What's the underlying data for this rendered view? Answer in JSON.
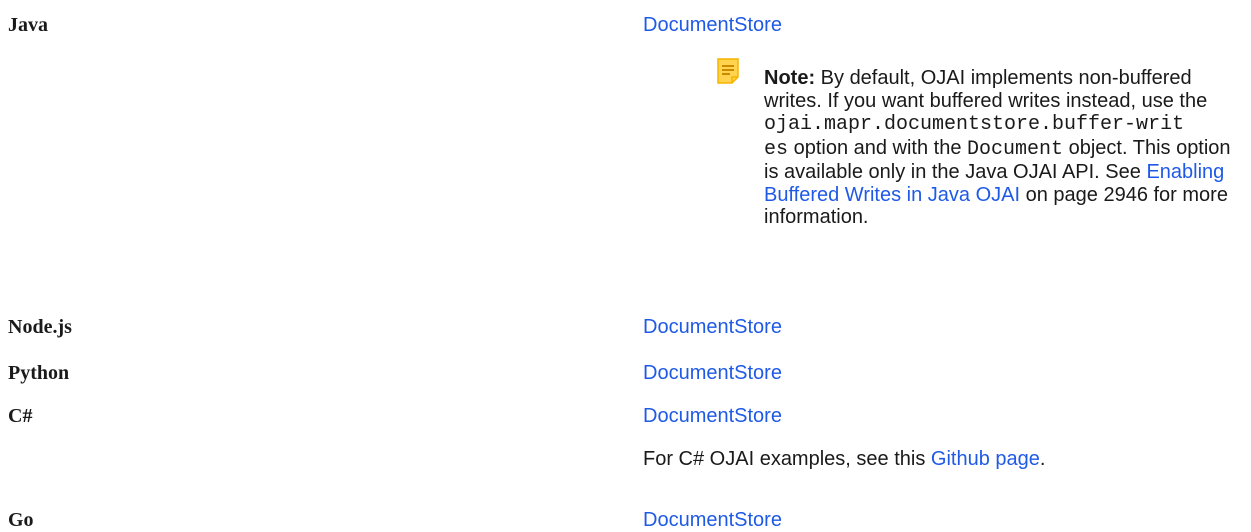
{
  "rows": [
    {
      "language": "Java",
      "link": "DocumentStore"
    },
    {
      "language": "Node.js",
      "link": "DocumentStore"
    },
    {
      "language": "Python",
      "link": "DocumentStore"
    },
    {
      "language": "C#",
      "link": "DocumentStore"
    },
    {
      "language": "Go",
      "link": "DocumentStore"
    }
  ],
  "note": {
    "icon": "note-icon",
    "label": "Note:",
    "text1": " By default, OJAI implements non-buffered writes. If you want buffered writes instead, use the ",
    "code1": "ojai.mapr.documentstore.buffer-writ",
    "code1b": "es",
    "text2": " option and with the ",
    "code2": "Document",
    "text3": " object. This option is available only in the Java OJAI API. See ",
    "link": "Enabling Buffered Writes in Java OJAI",
    "text4": " on page 2946 for more information."
  },
  "csharp": {
    "before": "For C# OJAI examples, see this ",
    "link": "Github page",
    "after": "."
  },
  "colors": {
    "link": "#1f5ae6",
    "note_icon": "#f5b400"
  }
}
